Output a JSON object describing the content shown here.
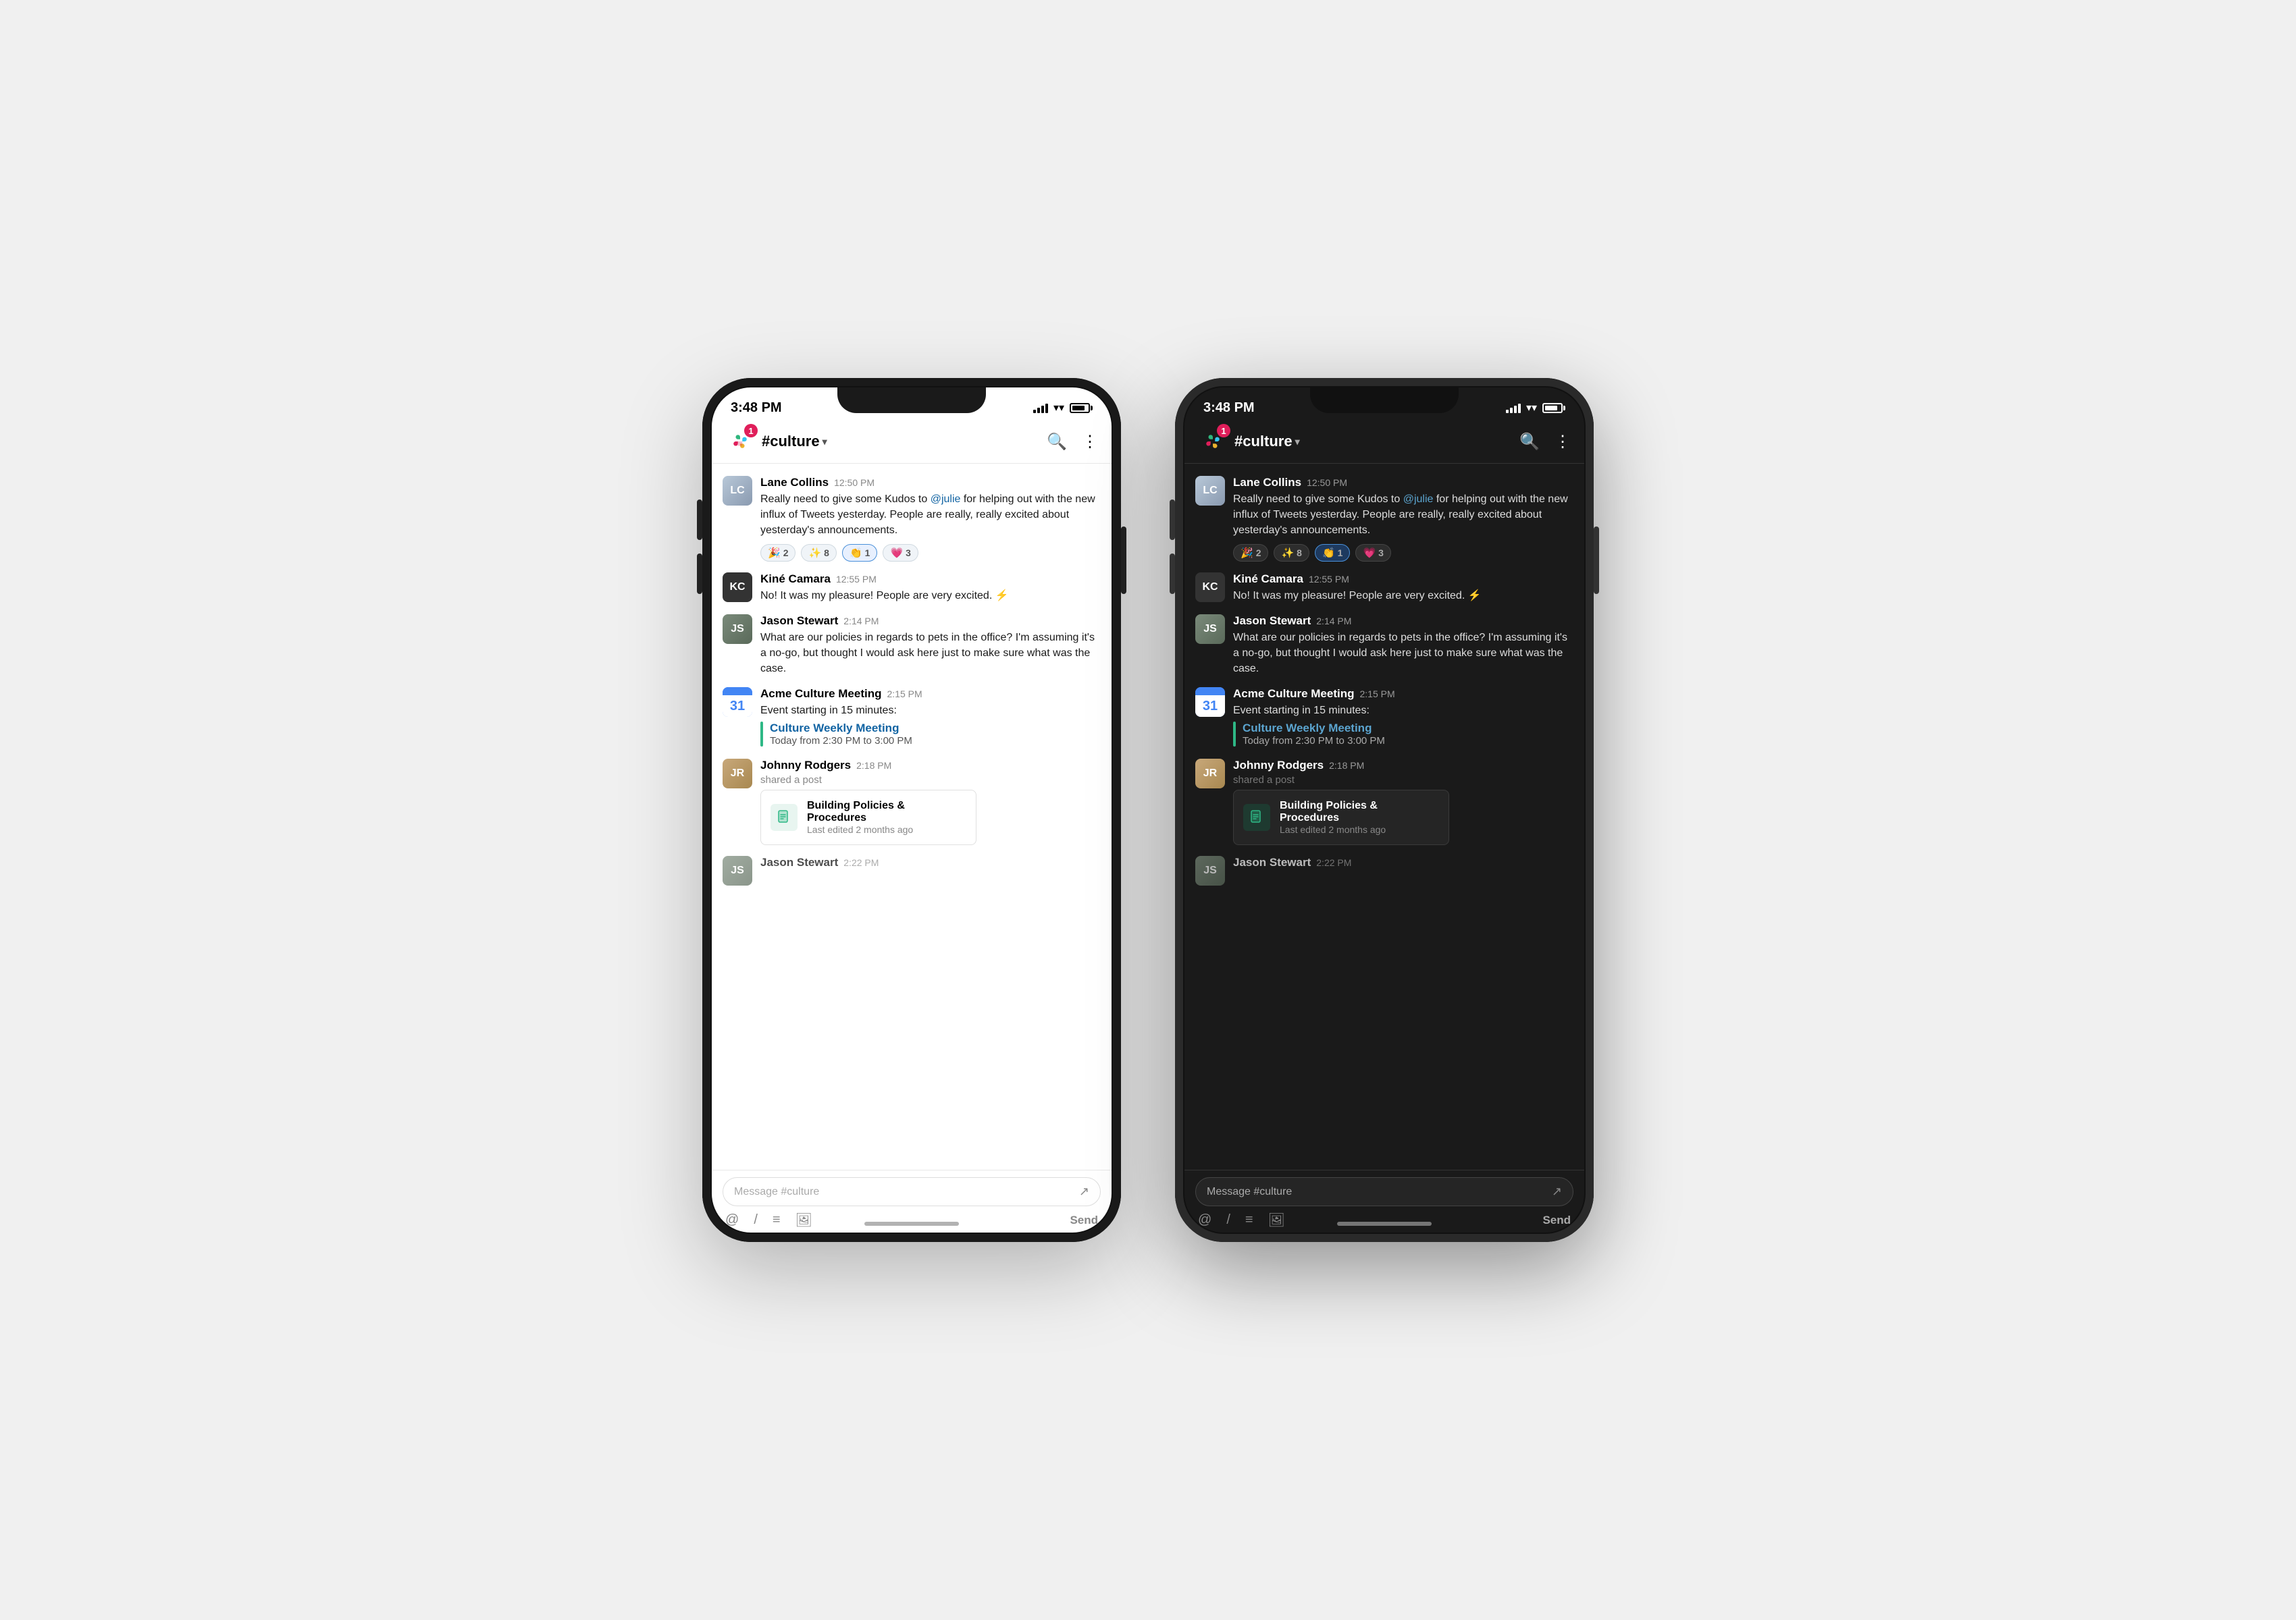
{
  "app": {
    "time": "3:48 PM",
    "channel": "#culture",
    "badge_count": "1"
  },
  "messages": [
    {
      "id": "lane",
      "sender": "Lane Collins",
      "time": "12:50 PM",
      "text": "Really need to give some Kudos to @julie for helping out with the new influx of Tweets yesterday. People are really, really excited about yesterday's announcements.",
      "mention": "@julie",
      "reactions": [
        {
          "emoji": "🎉",
          "count": "2",
          "highlighted": false
        },
        {
          "emoji": "✨",
          "count": "8",
          "highlighted": false
        },
        {
          "emoji": "👏",
          "count": "1",
          "highlighted": true
        },
        {
          "emoji": "💗",
          "count": "3",
          "highlighted": false
        }
      ]
    },
    {
      "id": "kine",
      "sender": "Kiné Camara",
      "time": "12:55 PM",
      "text": "No! It was my pleasure! People are very excited. ⚡"
    },
    {
      "id": "jason",
      "sender": "Jason Stewart",
      "time": "2:14 PM",
      "text": "What are our policies in regards to pets in the office? I'm assuming it's a no-go, but thought I would ask here just to make sure what was the case."
    },
    {
      "id": "acme",
      "sender": "Acme Culture Meeting",
      "time": "2:15 PM",
      "system_text": "Event starting in 15 minutes:",
      "event_name": "Culture Weekly Meeting",
      "event_time": "Today from 2:30 PM to 3:00 PM"
    },
    {
      "id": "johnny",
      "sender": "Johnny Rodgers",
      "time": "2:18 PM",
      "shared_label": "shared a post",
      "post_title": "Building Policies & Procedures",
      "post_meta": "Last edited 2 months ago"
    }
  ],
  "partial": {
    "sender": "Jason Stewart",
    "time": "2:22 PM"
  },
  "input": {
    "placeholder": "Message #culture",
    "send_label": "Send"
  },
  "toolbar": {
    "mention": "@",
    "slash": "/",
    "format": "≡",
    "image": "🖼"
  }
}
